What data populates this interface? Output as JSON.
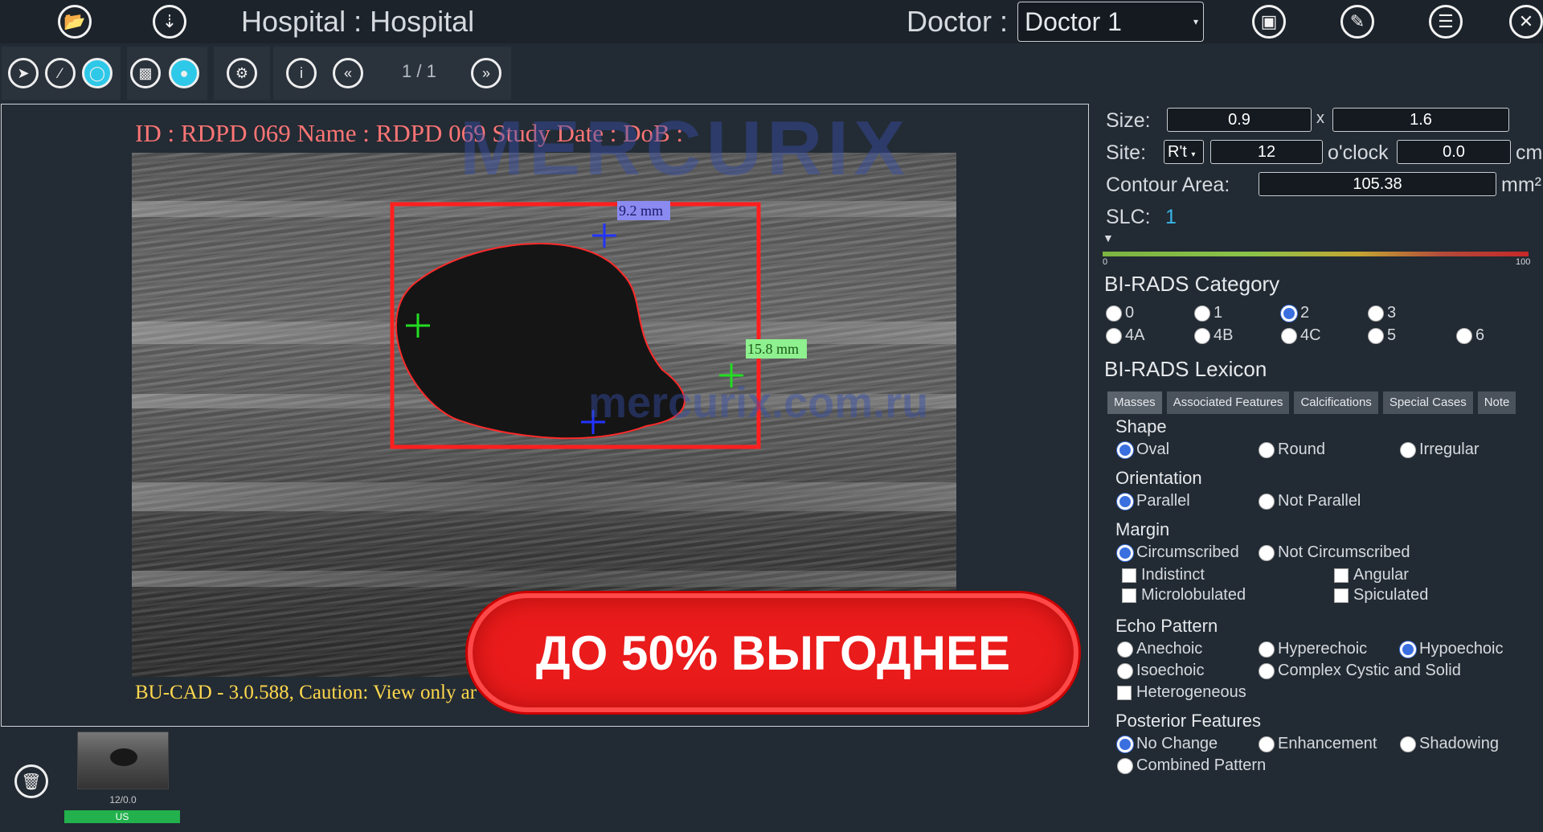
{
  "header": {
    "hospital_label": "Hospital : Hospital",
    "doctor_label": "Doctor :",
    "doctor_value": "Doctor 1"
  },
  "toolbar": {
    "page_indicator": "1 / 1"
  },
  "viewer": {
    "info_line": "ID : RDPD  069 Name : RDPD  069 Study Date :  DoB :",
    "watermark": "MERCURIX",
    "watermark_url": "mercurix.com.ru",
    "caution": "BU-CAD - 3.0.588, Caution: View only ar",
    "measure_1": "9.2 mm",
    "measure_2": "15.8 mm",
    "promo": "ДО 50% ВЫГОДНЕЕ"
  },
  "thumbnail": {
    "caption": "12/0.0",
    "modality": "US"
  },
  "panel": {
    "size_label": "Size:",
    "size_w": "0.9",
    "size_x": "x",
    "size_h": "1.6",
    "site_label": "Site:",
    "site_side": "R't",
    "site_clock": "12",
    "site_oclock": "o'clock",
    "site_cm": "0.0",
    "site_unit": "cm",
    "contour_label": "Contour Area:",
    "contour_value": "105.38",
    "contour_unit": "mm²",
    "slc_label": "SLC:",
    "slc_value": "1",
    "scale_min": "0",
    "scale_max": "100",
    "birads_category_title": "BI-RADS Category",
    "birads_categories": [
      "0",
      "1",
      "2",
      "3",
      "4A",
      "4B",
      "4C",
      "5",
      "6"
    ],
    "birads_selected": "2",
    "lexicon_title": "BI-RADS Lexicon",
    "tabs": [
      "Masses",
      "Associated Features",
      "Calcifications",
      "Special Cases",
      "Note"
    ],
    "shape": {
      "title": "Shape",
      "options": [
        "Oval",
        "Round",
        "Irregular"
      ]
    },
    "orientation": {
      "title": "Orientation",
      "options": [
        "Parallel",
        "Not Parallel"
      ]
    },
    "margin": {
      "title": "Margin",
      "options": [
        "Circumscribed",
        "Not Circumscribed"
      ],
      "checks": [
        "Indistinct",
        "Angular",
        "Microlobulated",
        "Spiculated"
      ]
    },
    "echo": {
      "title": "Echo Pattern",
      "options": [
        "Anechoic",
        "Hyperechoic",
        "Hypoechoic",
        "Isoechoic",
        "Complex Cystic and Solid"
      ],
      "check": "Heterogeneous"
    },
    "posterior": {
      "title": "Posterior Features",
      "options": [
        "No Change",
        "Enhancement",
        "Shadowing",
        "Combined Pattern"
      ]
    }
  },
  "colors": {
    "accent": "#3a6fe0",
    "info_text": "#ff7575",
    "caution_text": "#ffd84d",
    "slc_value": "#38b6e8",
    "promo_bg": "#ea1b1b"
  }
}
